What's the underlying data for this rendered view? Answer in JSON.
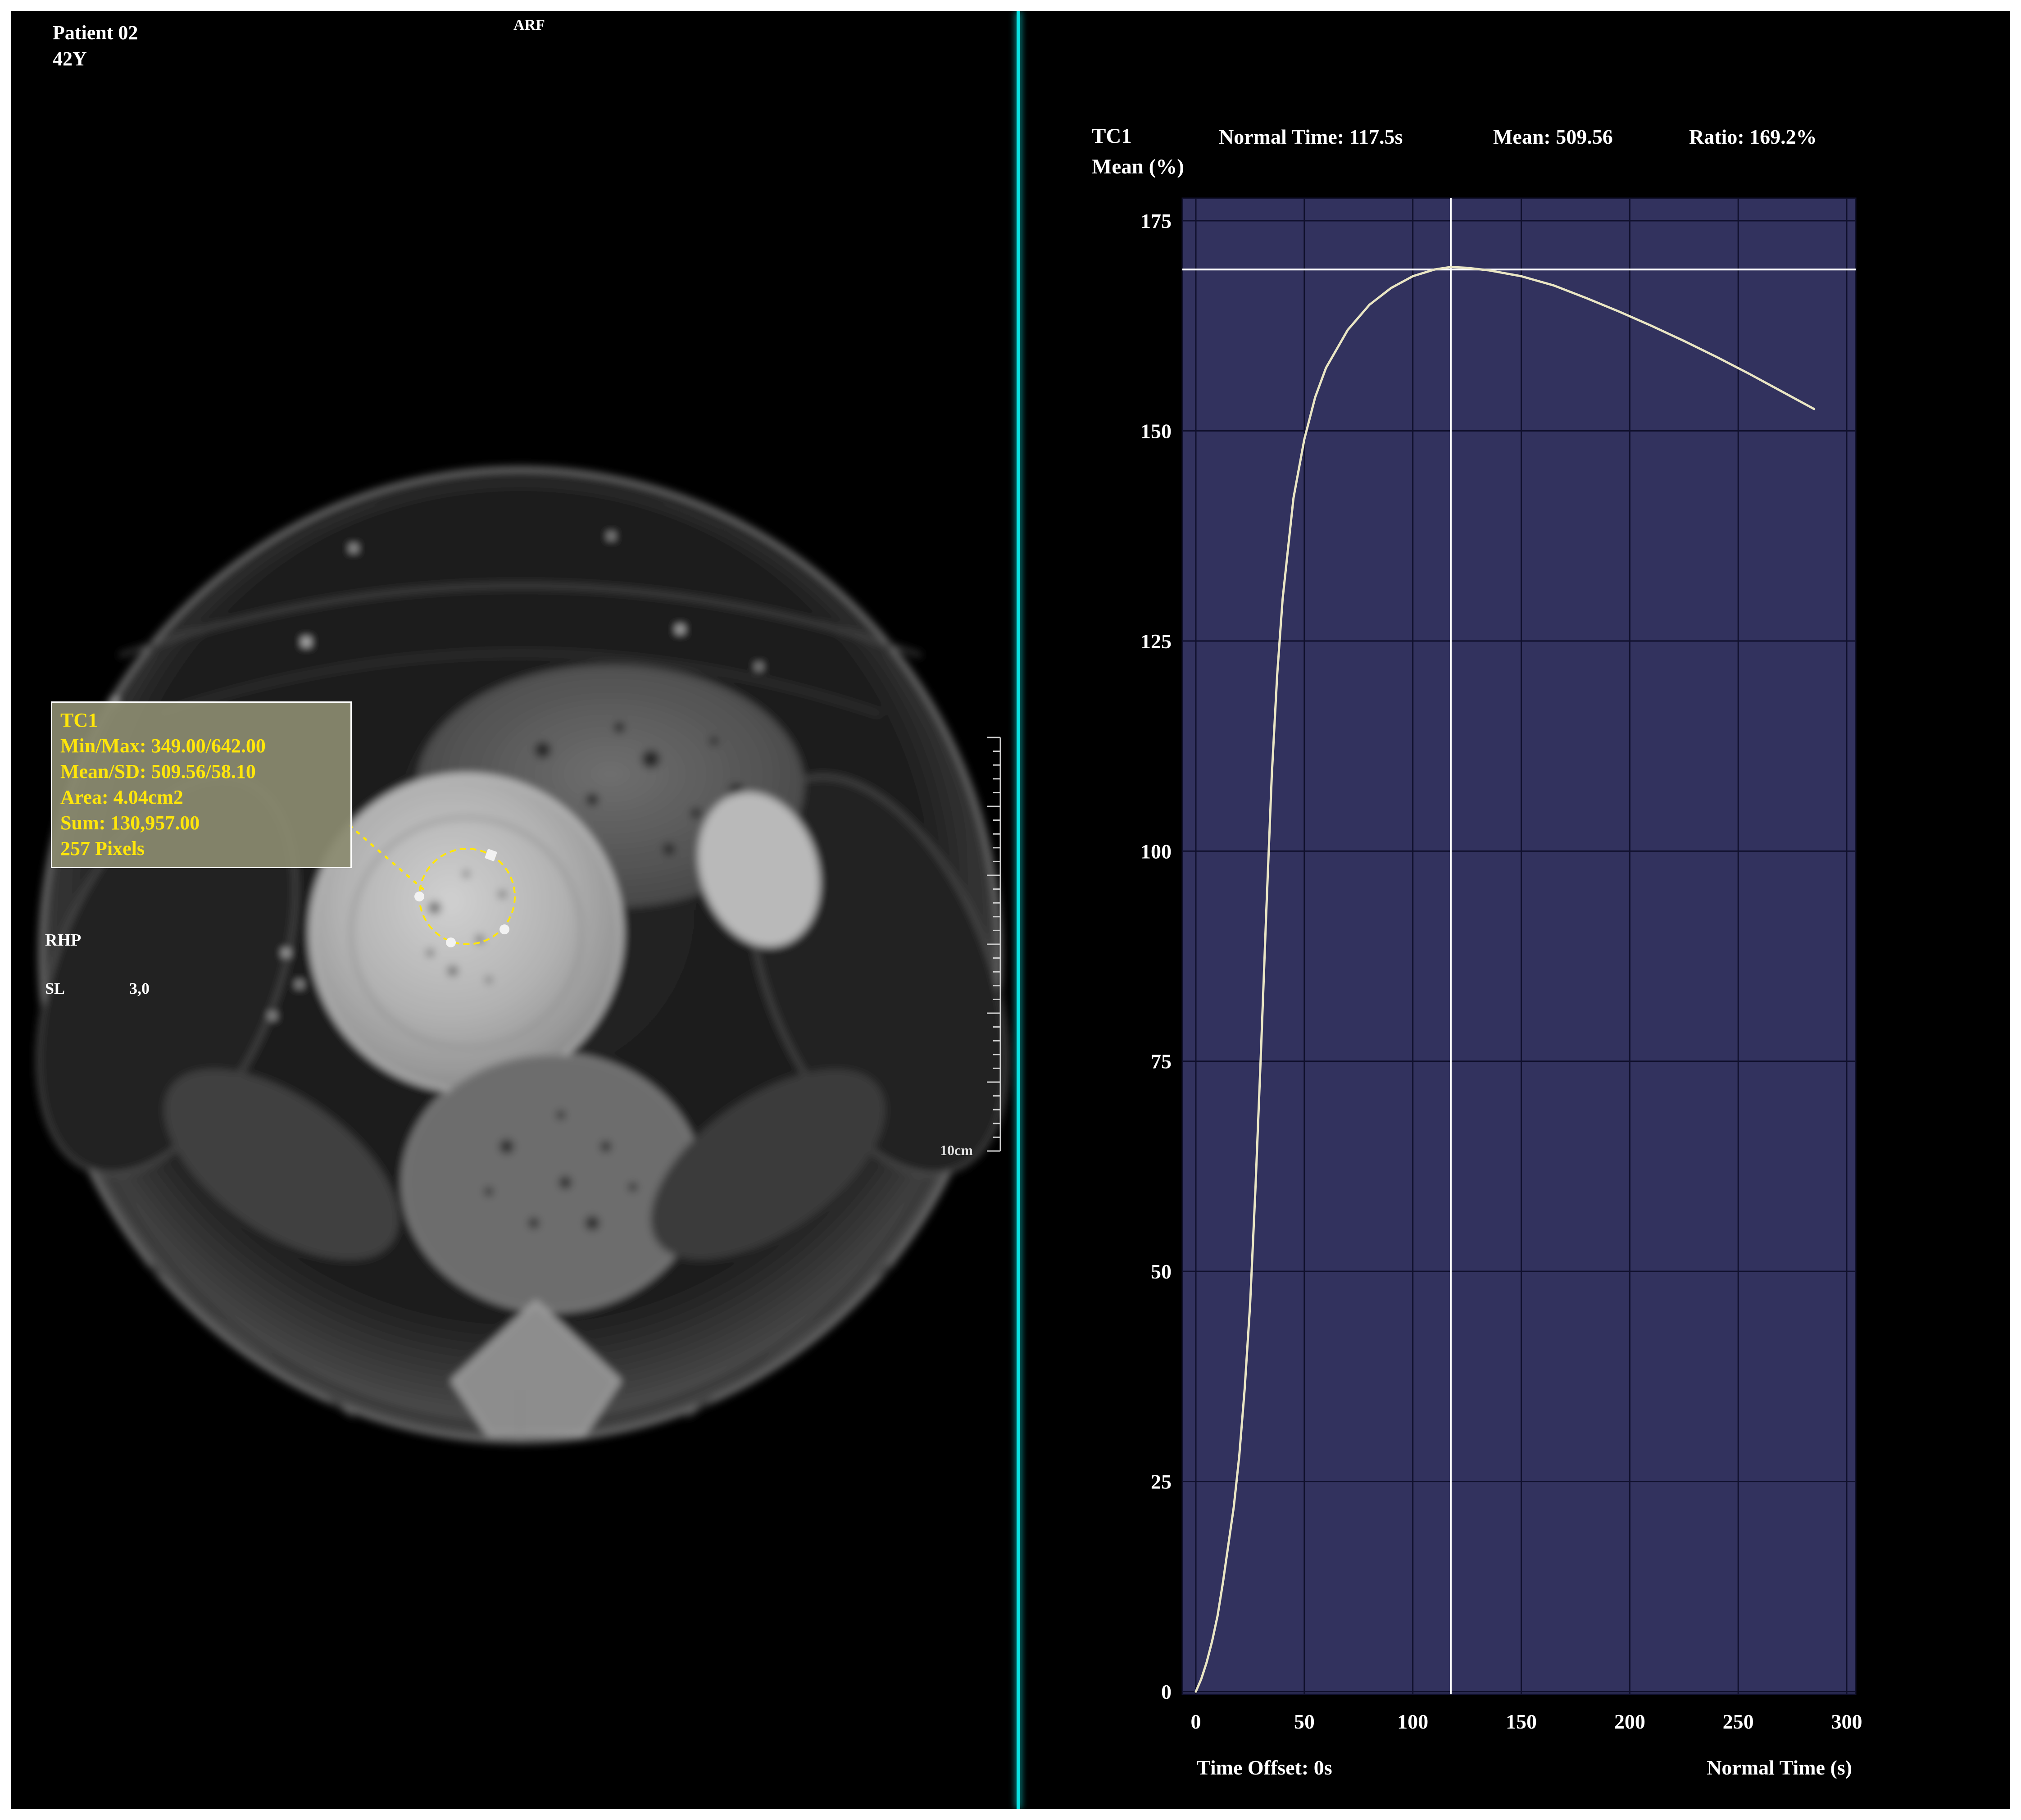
{
  "window": {
    "background": "#000000",
    "frame_color": "#ffffff",
    "divider_color": "#0ae2e2"
  },
  "image_panel": {
    "patient_id": "Patient 02",
    "patient_age": "42Y",
    "orientation_top": "ARF",
    "orientation_left": "RHP",
    "slice_label": "SL",
    "slice_thickness": "3,0",
    "ruler_label": "10cm",
    "roi_annotation": {
      "title": "TC1",
      "lines": [
        "Min/Max: 349.00/642.00",
        "Mean/SD: 509.56/58.10",
        "Area: 4.04cm2",
        "Sum: 130,957.00",
        "257 Pixels"
      ],
      "text_color": "#ffe60a"
    }
  },
  "chart_panel": {
    "curve_label": "TC1",
    "y_axis_title": "Mean (%)",
    "normal_time_stat": "Normal Time: 117.5s",
    "mean_stat": "Mean: 509.56",
    "ratio_stat": "Ratio: 169.2%",
    "time_offset_label": "Time Offset: 0s",
    "x_axis_title": "Normal Time (s)"
  },
  "chart_data": {
    "type": "line",
    "title": "TC1 time-intensity curve",
    "xlabel": "Normal Time (s)",
    "ylabel": "Mean (%)",
    "xlim": [
      0,
      300
    ],
    "ylim": [
      0,
      175
    ],
    "x_ticks": [
      0,
      50,
      100,
      150,
      200,
      250,
      300
    ],
    "y_ticks": [
      0,
      25,
      50,
      75,
      100,
      125,
      150,
      175
    ],
    "grid": true,
    "legend": "none",
    "cursor_time_s": 117.5,
    "ratio_level_pct": 169.2,
    "series": [
      {
        "name": "TC1",
        "x": [
          0,
          2.5,
          5,
          7.5,
          10,
          12.5,
          15,
          17.5,
          20,
          22.5,
          25,
          27.5,
          30,
          32.5,
          35,
          37.5,
          40,
          45,
          50,
          55,
          60,
          70,
          80,
          90,
          100,
          110,
          117.5,
          125,
          135,
          150,
          165,
          180,
          195,
          210,
          225,
          240,
          255,
          270,
          285
        ],
        "y": [
          0,
          1.5,
          3.5,
          6,
          9,
          13,
          17.5,
          22,
          28,
          36,
          46,
          60,
          76,
          93,
          109,
          121,
          130,
          142,
          149,
          154,
          157.5,
          162,
          165,
          167,
          168.4,
          169.2,
          169.5,
          169.4,
          169.1,
          168.4,
          167.3,
          165.8,
          164.2,
          162.5,
          160.7,
          158.8,
          156.8,
          154.7,
          152.6
        ]
      }
    ],
    "colors": {
      "curve": "#eae6c4",
      "plot_bg": "#32325e",
      "grid": "#10102c",
      "markers": "#ffffff"
    }
  }
}
